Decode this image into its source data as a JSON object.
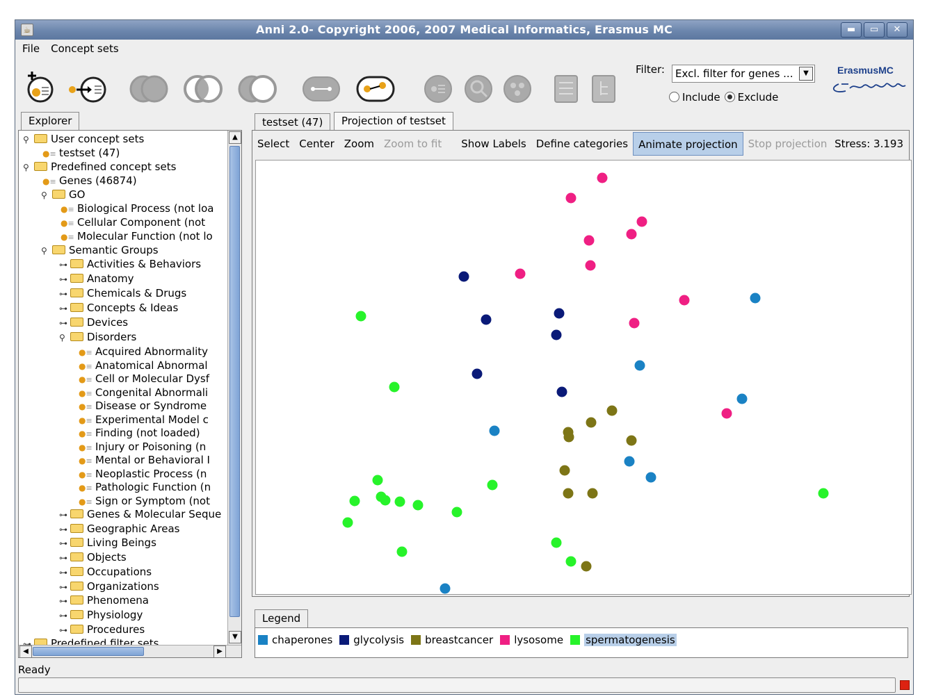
{
  "window": {
    "title": "Anni 2.0- Copyright 2006, 2007 Medical Informatics, Erasmus MC",
    "controls": {
      "minimize": "▬",
      "maximize": "▭",
      "close": "✕"
    }
  },
  "menu": [
    "File",
    "Concept sets"
  ],
  "toolbar": {
    "filter_label": "Filter:",
    "filter_value": "Excl. filter for genes ...",
    "include_label": "Include",
    "exclude_label": "Exclude",
    "selected_mode": "Exclude",
    "logo_text": "ErasmusMC"
  },
  "explorer": {
    "tab": "Explorer",
    "tree": [
      {
        "label": "User concept sets",
        "type": "folder",
        "depth": 0,
        "expanded": true
      },
      {
        "label": "testset (47)",
        "type": "leaf",
        "depth": 1
      },
      {
        "label": "Predefined concept sets",
        "type": "folder",
        "depth": 0,
        "expanded": true
      },
      {
        "label": "Genes (46874)",
        "type": "leaf",
        "depth": 1
      },
      {
        "label": "GO",
        "type": "folder",
        "depth": 1,
        "expanded": true
      },
      {
        "label": "Biological Process (not loa",
        "type": "leaf",
        "depth": 2
      },
      {
        "label": "Cellular Component (not",
        "type": "leaf",
        "depth": 2
      },
      {
        "label": "Molecular Function (not lo",
        "type": "leaf",
        "depth": 2
      },
      {
        "label": "Semantic Groups",
        "type": "folder",
        "depth": 1,
        "expanded": true
      },
      {
        "label": "Activities & Behaviors",
        "type": "folder",
        "depth": 2,
        "expanded": false
      },
      {
        "label": "Anatomy",
        "type": "folder",
        "depth": 2,
        "expanded": false
      },
      {
        "label": "Chemicals & Drugs",
        "type": "folder",
        "depth": 2,
        "expanded": false
      },
      {
        "label": "Concepts & Ideas",
        "type": "folder",
        "depth": 2,
        "expanded": false
      },
      {
        "label": "Devices",
        "type": "folder",
        "depth": 2,
        "expanded": false
      },
      {
        "label": "Disorders",
        "type": "folder",
        "depth": 2,
        "expanded": true
      },
      {
        "label": "Acquired Abnormality",
        "type": "leaf",
        "depth": 3
      },
      {
        "label": "Anatomical Abnormal",
        "type": "leaf",
        "depth": 3
      },
      {
        "label": "Cell or Molecular Dysf",
        "type": "leaf",
        "depth": 3
      },
      {
        "label": "Congenital Abnormali",
        "type": "leaf",
        "depth": 3
      },
      {
        "label": "Disease or Syndrome",
        "type": "leaf",
        "depth": 3
      },
      {
        "label": "Experimental Model c",
        "type": "leaf",
        "depth": 3
      },
      {
        "label": "Finding (not loaded)",
        "type": "leaf",
        "depth": 3
      },
      {
        "label": "Injury or Poisoning (n",
        "type": "leaf",
        "depth": 3
      },
      {
        "label": "Mental or Behavioral I",
        "type": "leaf",
        "depth": 3
      },
      {
        "label": "Neoplastic Process (n",
        "type": "leaf",
        "depth": 3
      },
      {
        "label": "Pathologic Function (n",
        "type": "leaf",
        "depth": 3
      },
      {
        "label": "Sign or Symptom (not",
        "type": "leaf",
        "depth": 3
      },
      {
        "label": "Genes & Molecular Seque",
        "type": "folder",
        "depth": 2,
        "expanded": false
      },
      {
        "label": "Geographic Areas",
        "type": "folder",
        "depth": 2,
        "expanded": false
      },
      {
        "label": "Living Beings",
        "type": "folder",
        "depth": 2,
        "expanded": false
      },
      {
        "label": "Objects",
        "type": "folder",
        "depth": 2,
        "expanded": false
      },
      {
        "label": "Occupations",
        "type": "folder",
        "depth": 2,
        "expanded": false
      },
      {
        "label": "Organizations",
        "type": "folder",
        "depth": 2,
        "expanded": false
      },
      {
        "label": "Phenomena",
        "type": "folder",
        "depth": 2,
        "expanded": false
      },
      {
        "label": "Physiology",
        "type": "folder",
        "depth": 2,
        "expanded": false
      },
      {
        "label": "Procedures",
        "type": "folder",
        "depth": 2,
        "expanded": false
      },
      {
        "label": "Predefined filter sets",
        "type": "folder",
        "depth": 0,
        "expanded": false
      }
    ]
  },
  "tabs": [
    {
      "label": "testset (47)"
    },
    {
      "label": "Projection of testset",
      "active": true
    }
  ],
  "projection": {
    "buttons": [
      {
        "label": "Select",
        "state": "normal"
      },
      {
        "label": "Center",
        "state": "normal"
      },
      {
        "label": "Zoom",
        "state": "normal"
      },
      {
        "label": "Zoom to fit",
        "state": "disabled"
      },
      {
        "label": "Show Labels",
        "state": "normal"
      },
      {
        "label": "Define categories",
        "state": "normal"
      },
      {
        "label": "Animate projection",
        "state": "active"
      },
      {
        "label": "Stop projection",
        "state": "disabled"
      }
    ],
    "stress": "Stress: 3.193"
  },
  "chart_data": {
    "type": "scatter",
    "title": "",
    "xlabel": "",
    "ylabel": "",
    "grid": false,
    "legend_position": "bottom",
    "series": [
      {
        "name": "chaperones",
        "color": "#1a82c4",
        "points": [
          [
            1084,
            429
          ],
          [
            918,
            526
          ],
          [
            1065,
            574
          ],
          [
            709,
            620
          ],
          [
            903,
            664
          ],
          [
            934,
            687
          ],
          [
            638,
            847
          ]
        ]
      },
      {
        "name": "glycolysis",
        "color": "#0a1a78",
        "points": [
          [
            665,
            398
          ],
          [
            802,
            451
          ],
          [
            697,
            460
          ],
          [
            798,
            482
          ],
          [
            684,
            538
          ],
          [
            806,
            564
          ]
        ]
      },
      {
        "name": "breastcancer",
        "color": "#7d7516",
        "points": [
          [
            878,
            591
          ],
          [
            848,
            608
          ],
          [
            815,
            622
          ],
          [
            816,
            629
          ],
          [
            906,
            634
          ],
          [
            810,
            677
          ],
          [
            815,
            710
          ],
          [
            850,
            710
          ],
          [
            841,
            815
          ]
        ]
      },
      {
        "name": "lysosome",
        "color": "#ef1f83",
        "points": [
          [
            864,
            256
          ],
          [
            819,
            285
          ],
          [
            921,
            319
          ],
          [
            906,
            337
          ],
          [
            845,
            346
          ],
          [
            847,
            382
          ],
          [
            746,
            394
          ],
          [
            982,
            432
          ],
          [
            910,
            465
          ],
          [
            1043,
            595
          ]
        ]
      },
      {
        "name": "spermatogenesis",
        "color": "#27f32a",
        "points": [
          [
            517,
            455
          ],
          [
            565,
            557
          ],
          [
            541,
            691
          ],
          [
            706,
            698
          ],
          [
            1182,
            710
          ],
          [
            508,
            721
          ],
          [
            546,
            715
          ],
          [
            552,
            720
          ],
          [
            573,
            722
          ],
          [
            599,
            727
          ],
          [
            655,
            737
          ],
          [
            498,
            752
          ],
          [
            798,
            781
          ],
          [
            576,
            794
          ],
          [
            819,
            808
          ]
        ]
      }
    ]
  },
  "legend": {
    "tab": "Legend",
    "selected": "spermatogenesis"
  },
  "status": {
    "text": "Ready"
  }
}
